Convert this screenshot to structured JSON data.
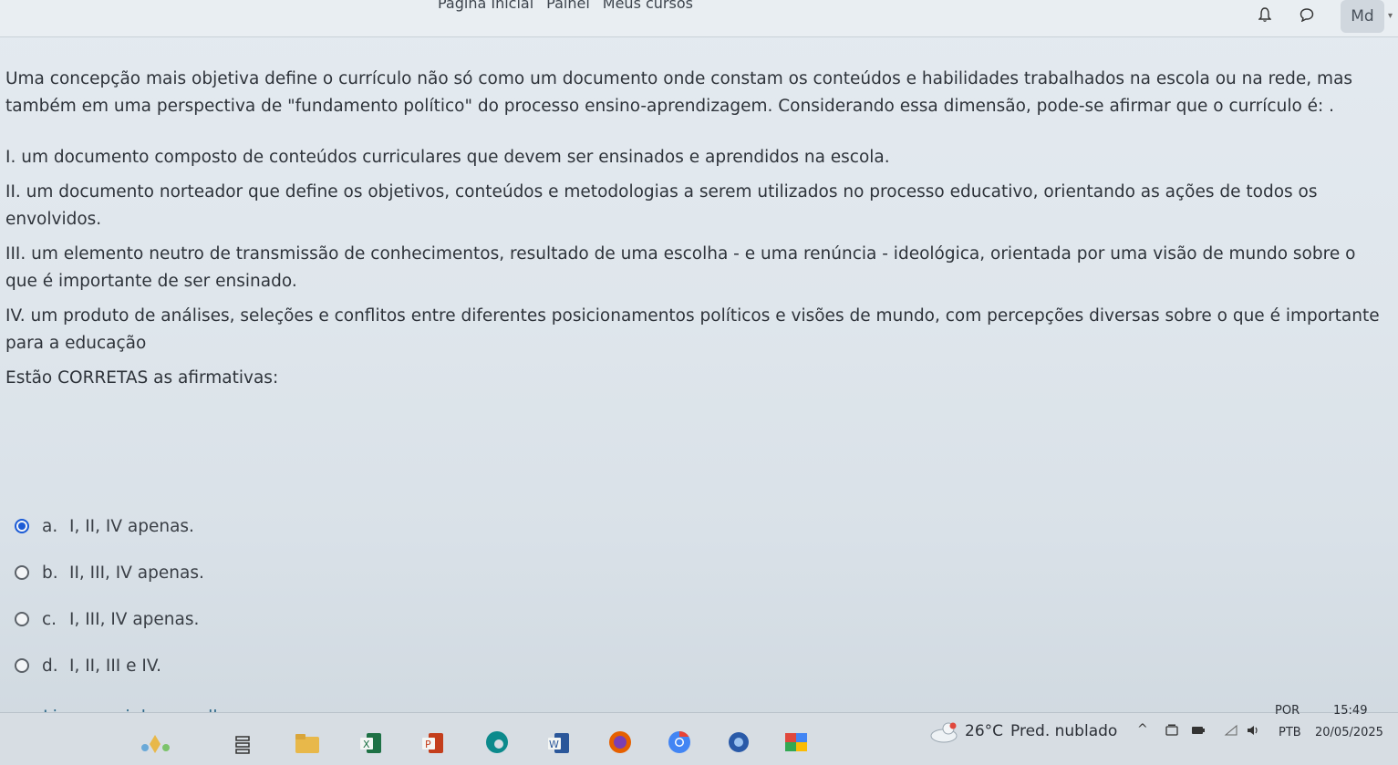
{
  "topbar": {
    "nav": [
      "Página Inicial",
      "Painel",
      "Meus cursos"
    ],
    "avatar_initials": "Md"
  },
  "question": {
    "stem": "Uma concepção mais objetiva define o currículo não só como um documento onde constam os conteúdos e habilidades trabalhados na escola ou na rede, mas também em uma perspectiva de \"fundamento político\" do processo ensino-aprendizagem. Considerando essa dimensão, pode-se afirmar que o currículo é: .",
    "items": [
      "I. um documento composto de conteúdos curriculares que devem ser ensinados e aprendidos na escola.",
      "II. um documento norteador que define os objetivos, conteúdos e metodologias a serem utilizados no processo educativo, orientando as ações de todos os envolvidos.",
      "III. um elemento neutro de transmissão de conhecimentos, resultado de uma escolha - e uma renúncia - ideológica, orientada por uma visão de mundo sobre o que é importante de ser ensinado.",
      "IV. um produto de análises, seleções e conflitos entre diferentes posicionamentos políticos e visões de mundo, com percepções diversas sobre o que é importante para a educação"
    ],
    "prompt": "Estão CORRETAS as afirmativas:",
    "options": [
      {
        "letter": "a.",
        "text": "I, II, IV apenas.",
        "selected": true
      },
      {
        "letter": "b.",
        "text": "II, III, IV apenas.",
        "selected": false
      },
      {
        "letter": "c.",
        "text": "I, III, IV apenas.",
        "selected": false
      },
      {
        "letter": "d.",
        "text": "I, II, III e IV.",
        "selected": false
      }
    ],
    "clear_label": "Limpar minha escolha"
  },
  "taskbar": {
    "weather_temp": "26°C",
    "weather_desc": "Pred. nublado",
    "lang_top": "POR",
    "lang_bottom": "PTB",
    "time": "15:49",
    "date": "20/05/2025",
    "icons": [
      "widgets-icon",
      "task-view-icon",
      "file-explorer-icon",
      "excel-icon",
      "powerpoint-icon",
      "edge-icon",
      "word-icon",
      "firefox-icon",
      "chrome-icon",
      "browser-icon",
      "app-icon"
    ],
    "colors": {
      "excel": "#1e7145",
      "powerpoint": "#c43e1c",
      "word": "#2b579a",
      "edge": "#0c8a8c",
      "firefox": "#e66000",
      "chrome": "#4285f4",
      "folder": "#e8b84a"
    }
  }
}
